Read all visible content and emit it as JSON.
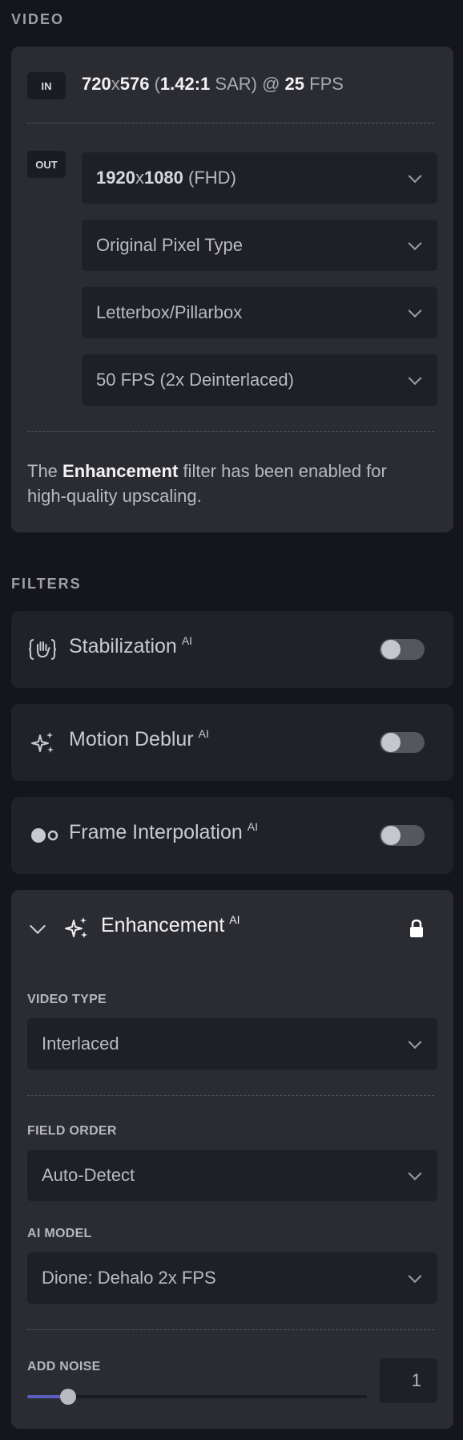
{
  "video": {
    "section_label": "VIDEO",
    "in_tag": "IN",
    "in_info": {
      "width": "720",
      "x": "x",
      "height": "576",
      "sar_open": "(",
      "sar": "1.42:1",
      "sar_suffix": "SAR) @",
      "fps": "25",
      "fps_label": "FPS"
    },
    "out_tag": "OUT",
    "outputs": [
      {
        "strong": "1920",
        "x": "x",
        "strong2": "1080",
        "rest": "(FHD)"
      },
      {
        "label": "Original Pixel Type"
      },
      {
        "label": "Letterbox/Pillarbox"
      },
      {
        "label": "50 FPS (2x Deinterlaced)"
      }
    ],
    "note": {
      "prefix": "The",
      "bold": "Enhancement",
      "suffix": "filter has been enabled for high-quality upscaling."
    }
  },
  "filters": {
    "section_label": "FILTERS",
    "ai_badge": "AI",
    "items": [
      {
        "label": "Stabilization",
        "icon": "stabilization-icon",
        "enabled": false
      },
      {
        "label": "Motion Deblur",
        "icon": "sparkles-icon",
        "enabled": false
      },
      {
        "label": "Frame Interpolation",
        "icon": "frame-interpolation-icon",
        "enabled": false
      }
    ],
    "enhancement": {
      "label": "Enhancement",
      "icon": "sparkles-icon",
      "locked": true,
      "video_type_label": "VIDEO TYPE",
      "video_type_value": "Interlaced",
      "field_order_label": "FIELD ORDER",
      "field_order_value": "Auto-Detect",
      "ai_model_label": "AI MODEL",
      "ai_model_value": "Dione: Dehalo 2x FPS",
      "add_noise_label": "ADD NOISE",
      "add_noise_value": "1",
      "add_noise_level": 0.12
    }
  },
  "colors": {
    "background": "#15161b",
    "card": "#2b2c31",
    "slider_fill": "#5a5fbf"
  }
}
